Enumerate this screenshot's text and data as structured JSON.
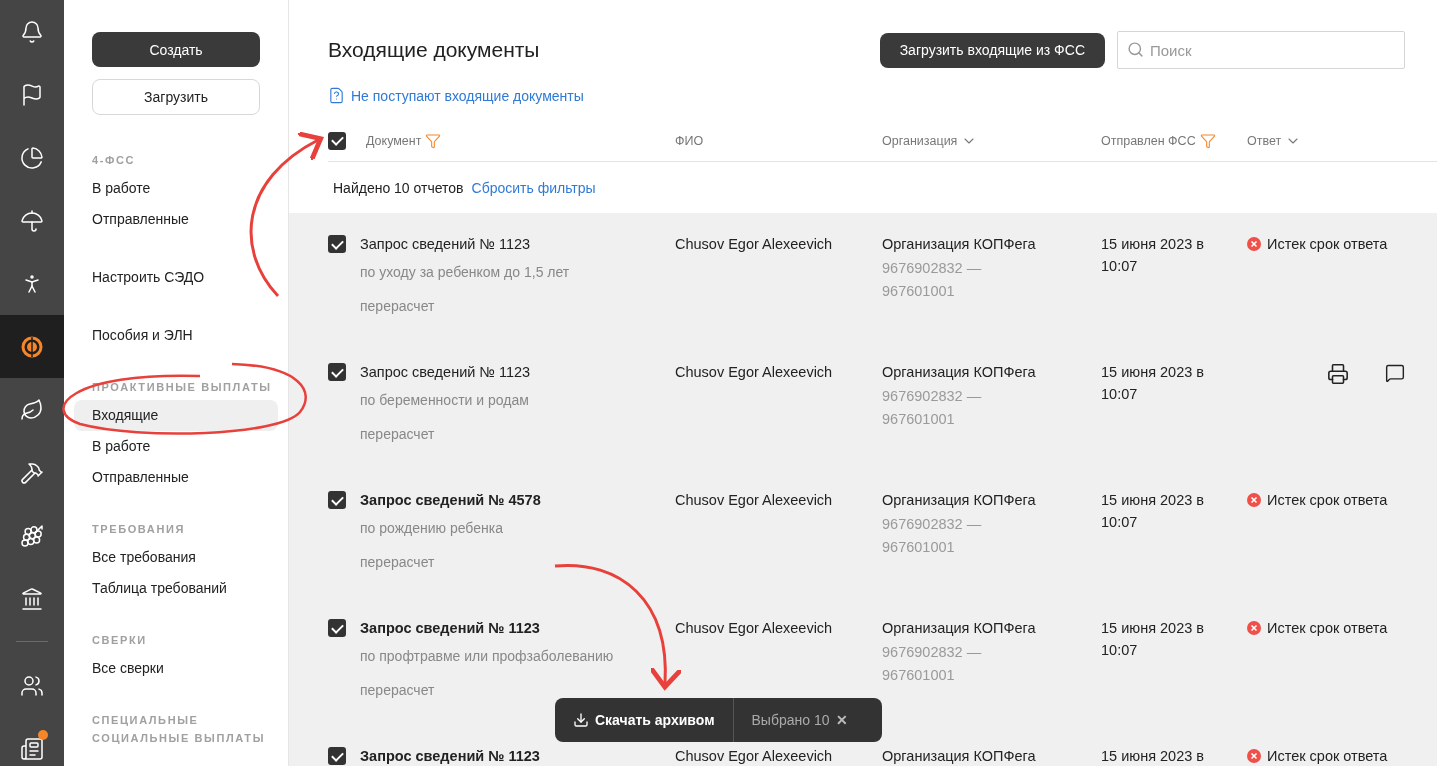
{
  "rail": [
    {
      "kind": "icon",
      "selected": false
    },
    {
      "kind": "icon",
      "selected": false
    },
    {
      "kind": "icon",
      "selected": false
    },
    {
      "kind": "icon",
      "selected": false
    },
    {
      "kind": "icon",
      "selected": false
    },
    {
      "kind": "icon",
      "selected": true
    },
    {
      "kind": "icon",
      "selected": false
    },
    {
      "kind": "icon",
      "selected": false
    },
    {
      "kind": "icon",
      "selected": false
    },
    {
      "kind": "icon",
      "selected": false
    },
    {
      "kind": "divider"
    },
    {
      "kind": "icon",
      "selected": false
    },
    {
      "kind": "icon",
      "selected": false,
      "badge": true
    }
  ],
  "sidebar": {
    "create_button": "Создать",
    "upload_button": "Загрузить",
    "sections": [
      {
        "heading": "4-ФСС",
        "items": [
          {
            "label": "В работе",
            "selected": false
          },
          {
            "label": "Отправленные",
            "selected": false
          }
        ]
      },
      {
        "items": [
          {
            "label": "Настроить СЭДО",
            "selected": false
          }
        ]
      },
      {
        "items": [
          {
            "label": "Пособия и ЭЛН",
            "selected": false
          }
        ]
      },
      {
        "heading": "ПРОАКТИВНЫЕ ВЫПЛАТЫ",
        "items": [
          {
            "label": "Входящие",
            "selected": true
          },
          {
            "label": "В работе",
            "selected": false
          },
          {
            "label": "Отправленные",
            "selected": false
          }
        ]
      },
      {
        "heading": "ТРЕБОВАНИЯ",
        "items": [
          {
            "label": "Все требования",
            "selected": false
          },
          {
            "label": "Таблица требований",
            "selected": false
          }
        ]
      },
      {
        "heading": "СВЕРКИ",
        "items": [
          {
            "label": "Все сверки",
            "selected": false
          }
        ]
      },
      {
        "heading": "СПЕЦИАЛЬНЫЕ СОЦИАЛЬНЫЕ ВЫПЛАТЫ"
      }
    ]
  },
  "header": {
    "title": "Входящие документы",
    "load_button": "Загрузить входящие из ФСС",
    "search": {
      "placeholder": "Поиск"
    },
    "help_link": "Не поступают входящие документы"
  },
  "table": {
    "select_all": {
      "checked": true
    },
    "columns": [
      {
        "label": "Документ",
        "kind": "filter"
      },
      {
        "label": "ФИО",
        "kind": "plain"
      },
      {
        "label": "Организация",
        "kind": "sort"
      },
      {
        "label": "Отправлен ФСС",
        "kind": "filter"
      },
      {
        "label": "Ответ",
        "kind": "sort"
      }
    ],
    "found_text": "Найдено 10 отчетов",
    "reset_link": "Сбросить фильтры",
    "rows": [
      {
        "checked": true,
        "bold": false,
        "title": "Запрос сведений № 1123",
        "subtitle": "по уходу за ребенком до 1,5 лет",
        "note": "перерасчет",
        "fio": "Chusov Egor Alexeevich",
        "org": "Организация КОПФега",
        "inn": "9676902832 — 967601001",
        "date": "15 июня 2023 в 10:07",
        "kind": "status",
        "status": "Истек срок ответа"
      },
      {
        "checked": true,
        "bold": false,
        "title": "Запрос сведений № 1123",
        "subtitle": "по беременности и родам",
        "note": "перерасчет",
        "fio": "Chusov Egor Alexeevich",
        "org": "Организация КОПФега",
        "inn": "9676902832 — 967601001",
        "date": "15 июня 2023 в 10:07",
        "kind": "actions"
      },
      {
        "checked": true,
        "bold": true,
        "title": "Запрос сведений № 4578",
        "subtitle": "по рождению ребенка",
        "note": "перерасчет",
        "fio": "Chusov Egor Alexeevich",
        "org": "Организация КОПФега",
        "inn": "9676902832 — 967601001",
        "date": "15 июня 2023 в 10:07",
        "kind": "status",
        "status": "Истек срок ответа"
      },
      {
        "checked": true,
        "bold": true,
        "title": "Запрос сведений № 1123",
        "subtitle": "по профтравме или профзаболеванию",
        "note": "перерасчет",
        "fio": "Chusov Egor Alexeevich",
        "org": "Организация КОПФега",
        "inn": "9676902832 — 967601001",
        "date": "15 июня 2023 в 10:07",
        "kind": "status",
        "status": "Истек срок ответа"
      },
      {
        "checked": true,
        "bold": true,
        "title": "Запрос сведений № 1123",
        "fio": "Chusov Egor Alexeevich",
        "org": "Организация КОПФега",
        "date": "15 июня 2023 в",
        "kind": "status",
        "status": "Истек срок ответа"
      }
    ]
  },
  "action_bar": {
    "download_button": "Скачать архивом",
    "selected_text": "Выбрано 10",
    "close": "✕"
  }
}
